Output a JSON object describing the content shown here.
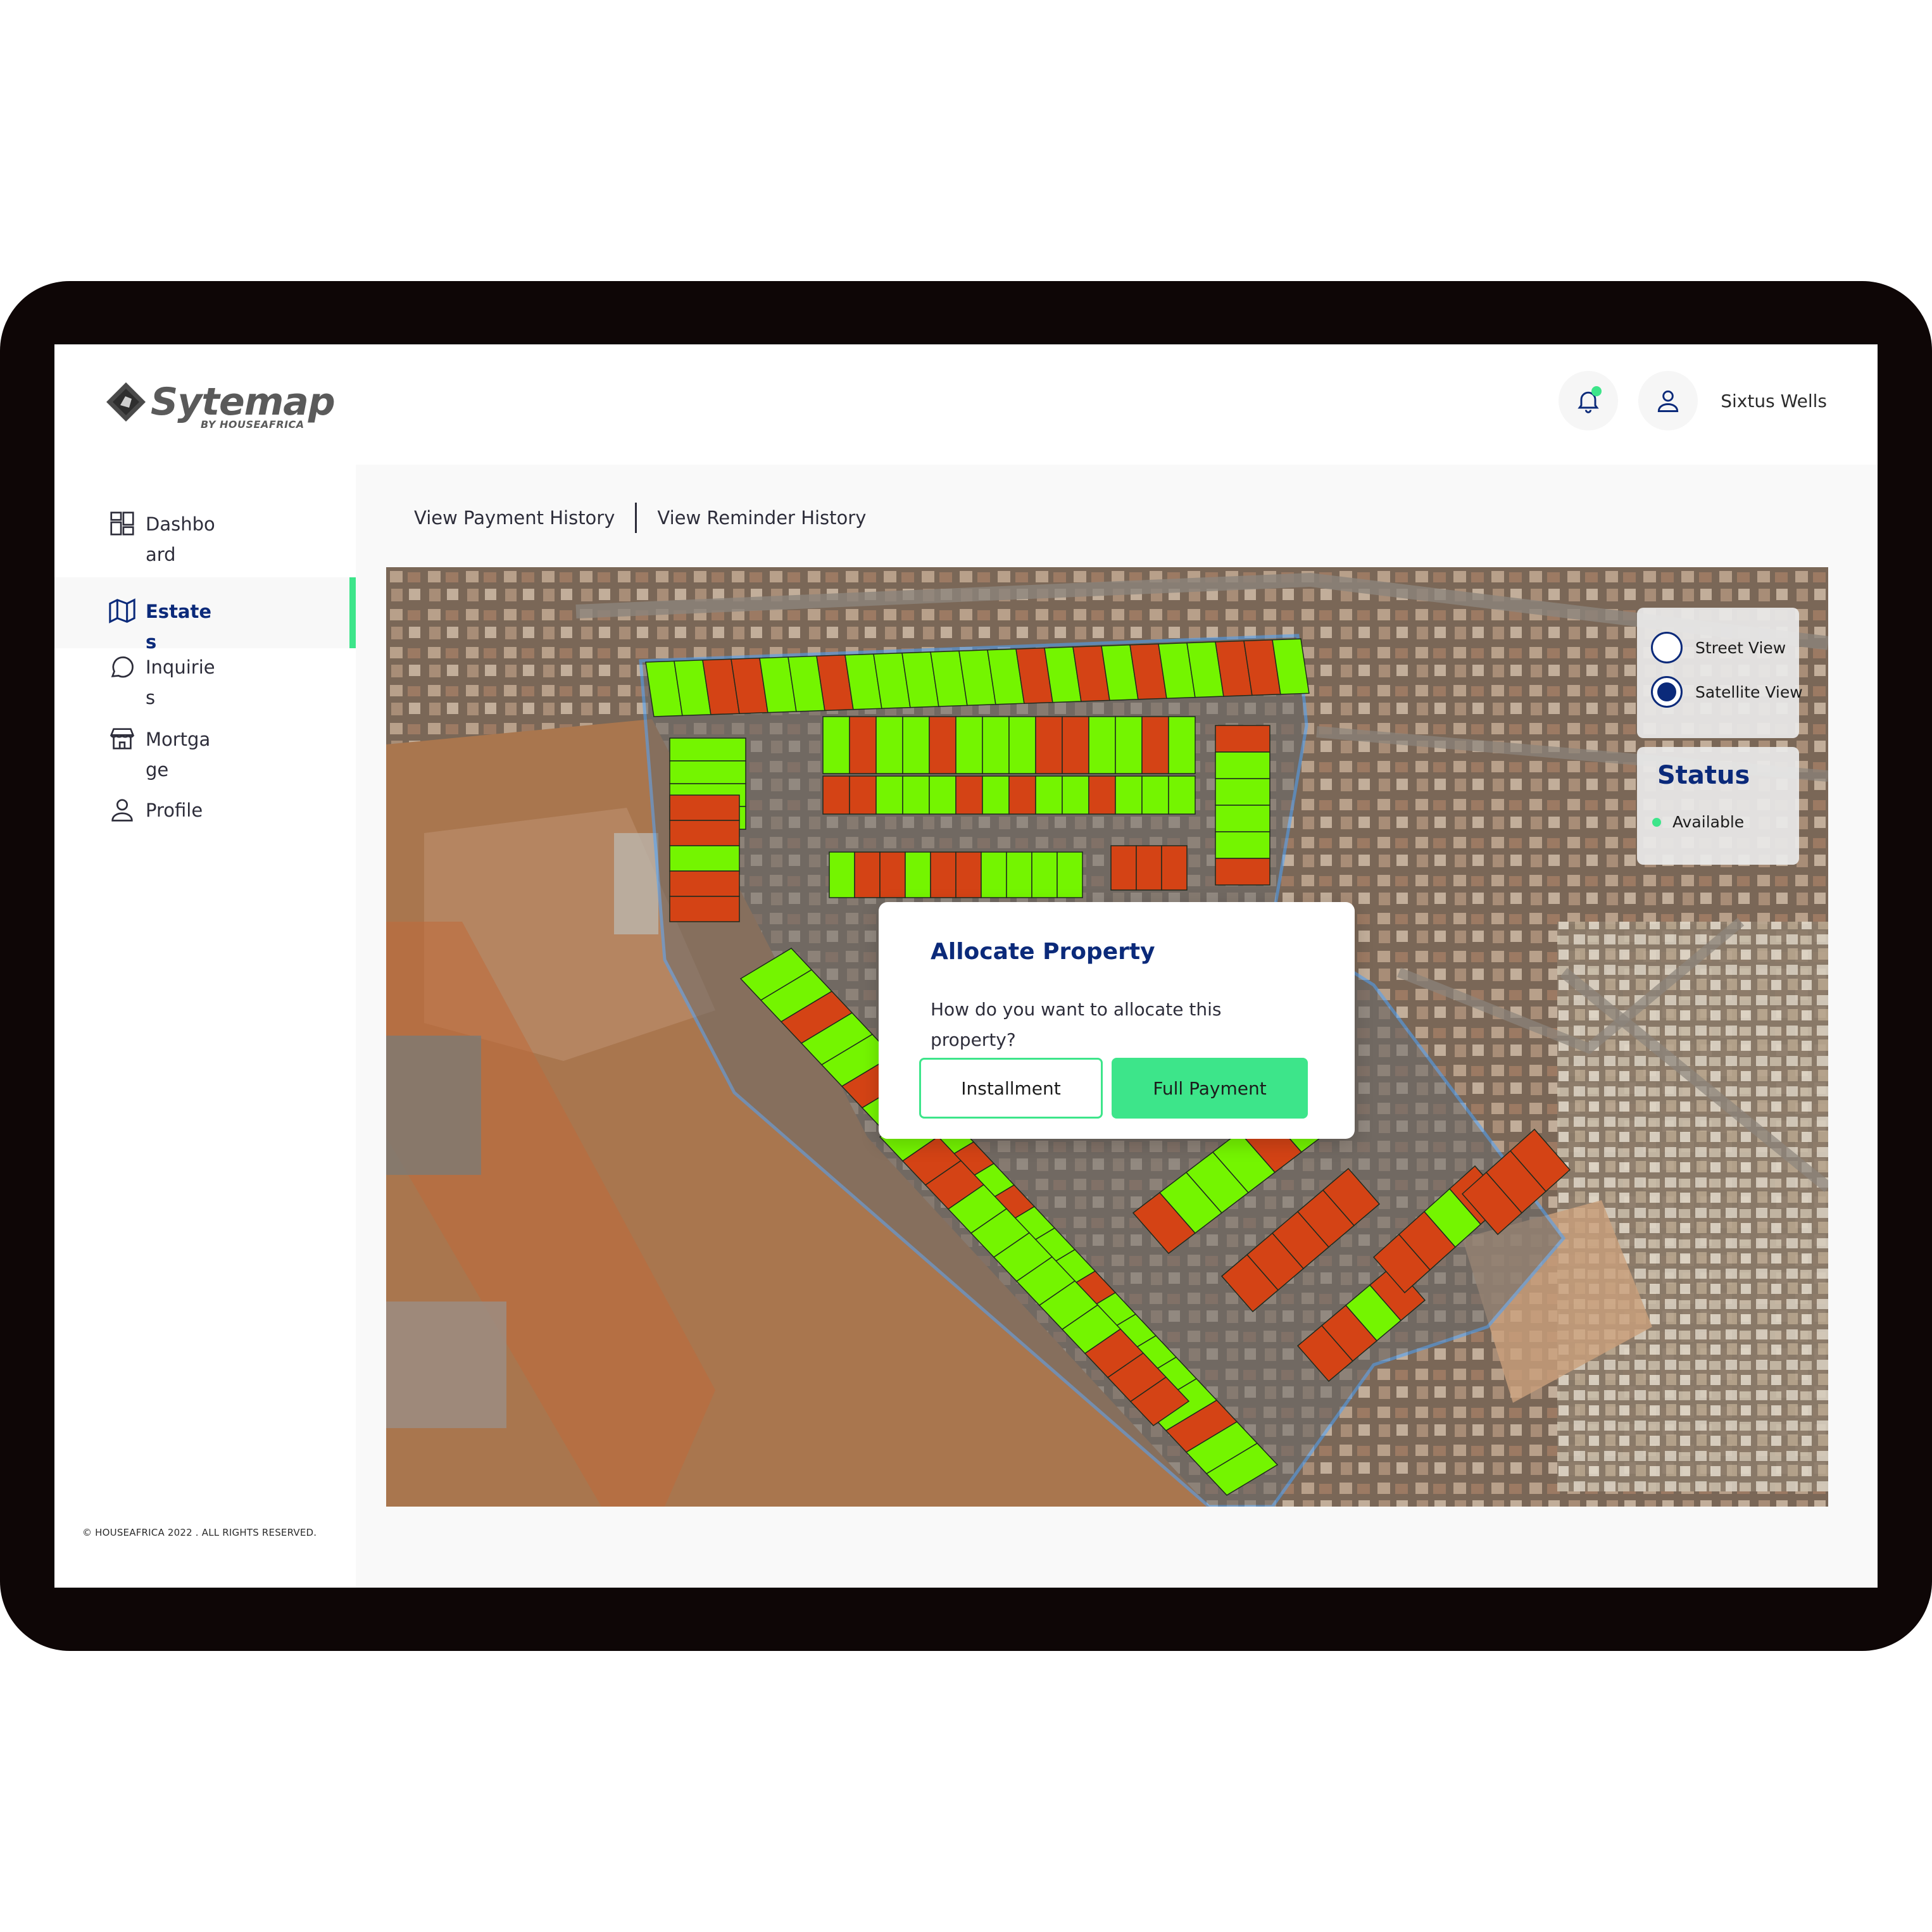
{
  "brand": {
    "name": "Sytemap",
    "sub": "BY HOUSEAFRICA"
  },
  "header": {
    "user_name": "Sixtus Wells"
  },
  "sidebar": {
    "items": [
      {
        "label": "Dashboard",
        "icon": "dashboard-icon",
        "active": false
      },
      {
        "label": "Estates",
        "icon": "map-icon",
        "active": true
      },
      {
        "label": "Inquiries",
        "icon": "chat-bubble-icon",
        "active": false
      },
      {
        "label": "Mortgage",
        "icon": "storefront-icon",
        "active": false
      },
      {
        "label": "Profile",
        "icon": "user-icon",
        "active": false
      }
    ],
    "copyright": "© HOUSEAFRICA 2022 . ALL RIGHTS RESERVED."
  },
  "tabs": {
    "payment_history": "View Payment History",
    "reminder_history": "View Reminder History"
  },
  "map_controls": {
    "street_view": "Street View",
    "satellite_view": "Satellite View",
    "selected": "Satellite View"
  },
  "status_legend": {
    "title": "Status",
    "items": [
      {
        "label": "Available",
        "color": "#3de58a"
      }
    ]
  },
  "plot_colors": {
    "available": "#74f500",
    "taken": "#d44315",
    "outline": "#4aa3ff"
  },
  "modal": {
    "title": "Allocate Property",
    "question": "How do you want to allocate this property?",
    "installment_label": "Installment",
    "full_payment_label": "Full Payment"
  },
  "colors": {
    "primary": "#0b2a7a",
    "accent": "#3de58a"
  }
}
